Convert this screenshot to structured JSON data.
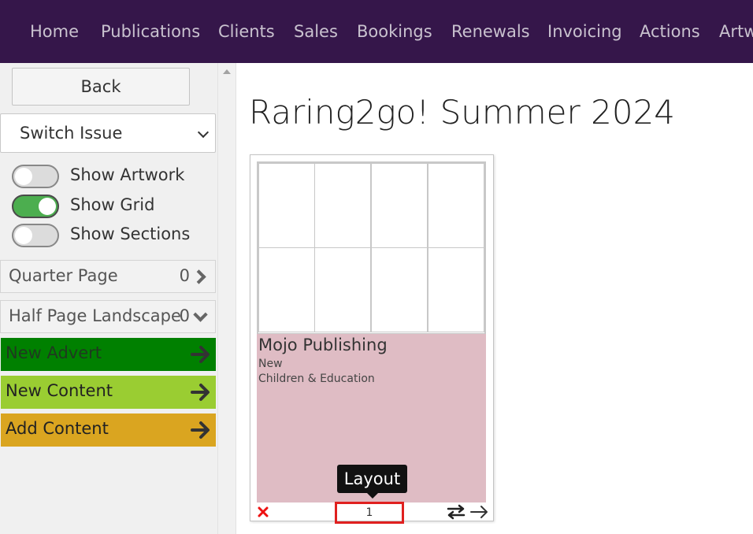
{
  "topnav": {
    "items": [
      "Home",
      "Publications",
      "Clients",
      "Sales",
      "Bookings",
      "Renewals",
      "Invoicing",
      "Actions",
      "Artwork"
    ]
  },
  "sidebar": {
    "back_label": "Back",
    "switch_issue_label": "Switch Issue",
    "toggles": [
      {
        "label": "Show Artwork",
        "on": false
      },
      {
        "label": "Show Grid",
        "on": true
      },
      {
        "label": "Show Sections",
        "on": false
      }
    ],
    "sizes": [
      {
        "label": "Quarter Page",
        "count": "0",
        "expanded": false
      },
      {
        "label": "Half Page Landscape",
        "count": "0",
        "expanded": true
      }
    ],
    "actions": [
      {
        "label": "New Advert",
        "color": "#008000",
        "text_color": "#1f3a1f"
      },
      {
        "label": "New Content",
        "color": "#9acd32",
        "text_color": "#222222"
      },
      {
        "label": "Add Content",
        "color": "#daa520",
        "text_color": "#222222"
      }
    ]
  },
  "main": {
    "title": "Raring2go! Summer 2024",
    "ad": {
      "title": "Mojo Publishing",
      "status": "New",
      "category": "Children & Education",
      "color": "#dfbcc4"
    },
    "page_number": "1",
    "tooltip": "Layout"
  }
}
